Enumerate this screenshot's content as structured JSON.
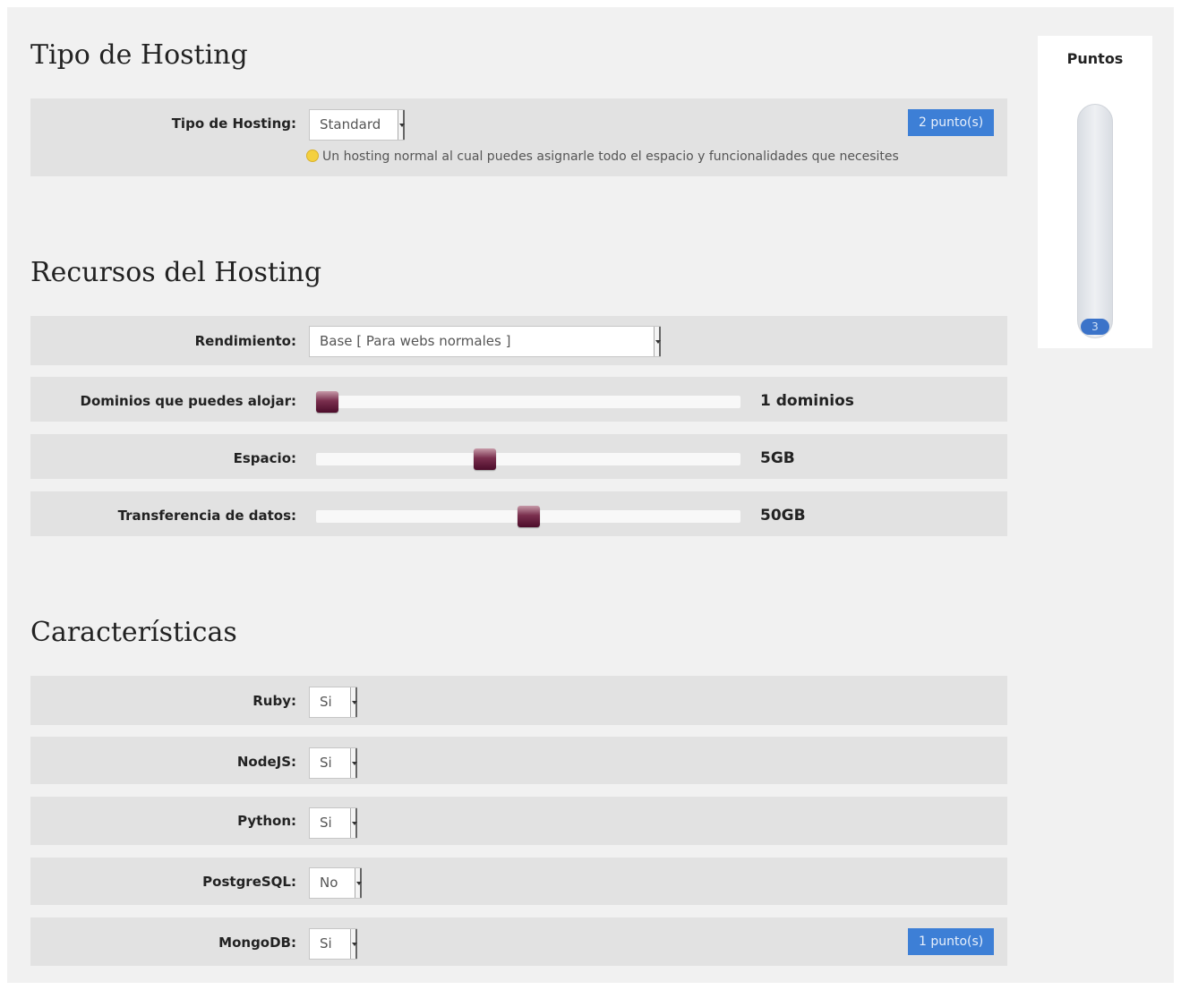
{
  "tipo": {
    "heading": "Tipo de Hosting",
    "label": "Tipo de Hosting:",
    "select_value": "Standard",
    "badge": "2 punto(s)",
    "hint": "Un hosting normal al cual puedes asignarle todo el espacio y funcionalidades que necesites"
  },
  "recursos": {
    "heading": "Recursos del Hosting",
    "rendimiento": {
      "label": "Rendimiento:",
      "select_value": "Base [ Para webs normales ]"
    },
    "sliders": [
      {
        "label": "Dominios que puedes alojar:",
        "value": "1 dominios",
        "level": 0.0
      },
      {
        "label": "Espacio:",
        "value": "5GB",
        "level": 0.39
      },
      {
        "label": "Transferencia de datos:",
        "value": "50GB",
        "level": 0.5
      }
    ]
  },
  "caracteristicas": {
    "heading": "Características",
    "items": [
      {
        "label": "Ruby:",
        "value": "Si"
      },
      {
        "label": "NodeJS:",
        "value": "Si"
      },
      {
        "label": "Python:",
        "value": "Si"
      },
      {
        "label": "PostgreSQL:",
        "value": "No"
      },
      {
        "label": "MongoDB:",
        "value": "Si"
      }
    ],
    "mongo_badge": "1 punto(s)"
  },
  "puntos": {
    "title": "Puntos",
    "value": "3",
    "level": 0.0
  },
  "colors": {
    "badge_blue": "#3d7fd6",
    "slider_thumb": "#6b1f40",
    "row_bg": "#e2e2e2",
    "panel_bg": "#f1f1f1"
  },
  "icons": [
    "lightbulb-icon",
    "dropdown-arrow-icon"
  ]
}
